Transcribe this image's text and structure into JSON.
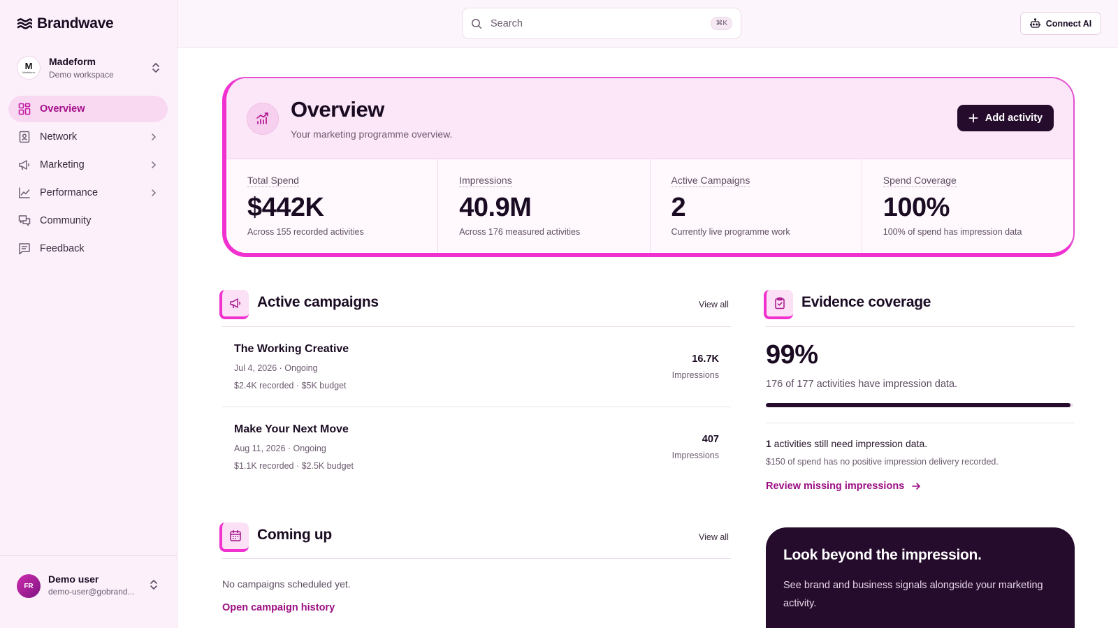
{
  "brand": {
    "name": "Brandwave"
  },
  "workspace": {
    "logo_text": "M",
    "logo_sub": "Madeform",
    "name": "Madeform",
    "subtitle": "Demo workspace"
  },
  "nav": {
    "items": [
      {
        "label": "Overview",
        "icon": "grid-icon",
        "active": true
      },
      {
        "label": "Network",
        "icon": "contact-icon"
      },
      {
        "label": "Marketing",
        "icon": "megaphone-icon"
      },
      {
        "label": "Performance",
        "icon": "line-chart-icon"
      },
      {
        "label": "Community",
        "icon": "chat-icon"
      },
      {
        "label": "Feedback",
        "icon": "feedback-icon"
      }
    ]
  },
  "user": {
    "initials": "FR",
    "name": "Demo user",
    "email": "demo-user@gobrand..."
  },
  "topbar": {
    "search_placeholder": "Search",
    "shortcut": "⌘K",
    "connect_label": "Connect AI"
  },
  "overview": {
    "title": "Overview",
    "subtitle": "Your marketing programme overview.",
    "add_label": "Add activity",
    "stats": [
      {
        "label": "Total Spend",
        "value": "$442K",
        "note": "Across 155 recorded activities"
      },
      {
        "label": "Impressions",
        "value": "40.9M",
        "note": "Across 176 measured activities"
      },
      {
        "label": "Active Campaigns",
        "value": "2",
        "note": "Currently live programme work"
      },
      {
        "label": "Spend Coverage",
        "value": "100%",
        "note": "100% of spend has impression data"
      }
    ]
  },
  "active_campaigns": {
    "title": "Active campaigns",
    "view_all": "View all",
    "items": [
      {
        "name": "The Working Creative",
        "dates": "Jul 4, 2026 · Ongoing",
        "budget": "$2.4K recorded · $5K budget",
        "value": "16.7K",
        "value_label": "Impressions"
      },
      {
        "name": "Make Your Next Move",
        "dates": "Aug 11, 2026 · Ongoing",
        "budget": "$1.1K recorded · $2.5K budget",
        "value": "407",
        "value_label": "Impressions"
      }
    ]
  },
  "coming_up": {
    "title": "Coming up",
    "view_all": "View all",
    "empty": "No campaigns scheduled yet.",
    "link": "Open campaign history"
  },
  "evidence": {
    "title": "Evidence coverage",
    "value": "99%",
    "fill_percent": 99,
    "desc": "176 of 177 activities have impression data.",
    "need_count": "1",
    "need_text": " activities still need impression data.",
    "need_sub": "$150 of spend has no positive impression delivery recorded.",
    "review_link": "Review missing impressions"
  },
  "promo": {
    "title": "Look beyond the impression.",
    "text": "See brand and business signals alongside your marketing activity."
  },
  "colors": {
    "accent": "#f030cf",
    "dark": "#250b2c",
    "link": "#9c0f83",
    "sidebar_bg": "#fcf1fb"
  }
}
